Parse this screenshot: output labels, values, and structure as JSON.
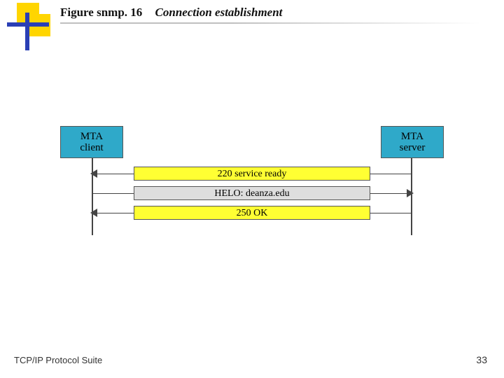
{
  "title": {
    "figure_label": "Figure snmp. 16",
    "caption": "Connection establishment"
  },
  "endpoints": {
    "left": {
      "line1": "MTA",
      "line2": "client"
    },
    "right": {
      "line1": "MTA",
      "line2": "server"
    }
  },
  "messages": [
    {
      "text": "220 service ready",
      "direction": "to-client",
      "style": "yellow"
    },
    {
      "text": "HELO: deanza.edu",
      "direction": "to-server",
      "style": "grey"
    },
    {
      "text": "250 OK",
      "direction": "to-client",
      "style": "yellow"
    }
  ],
  "footer": {
    "left": "TCP/IP Protocol Suite",
    "page": "33"
  }
}
